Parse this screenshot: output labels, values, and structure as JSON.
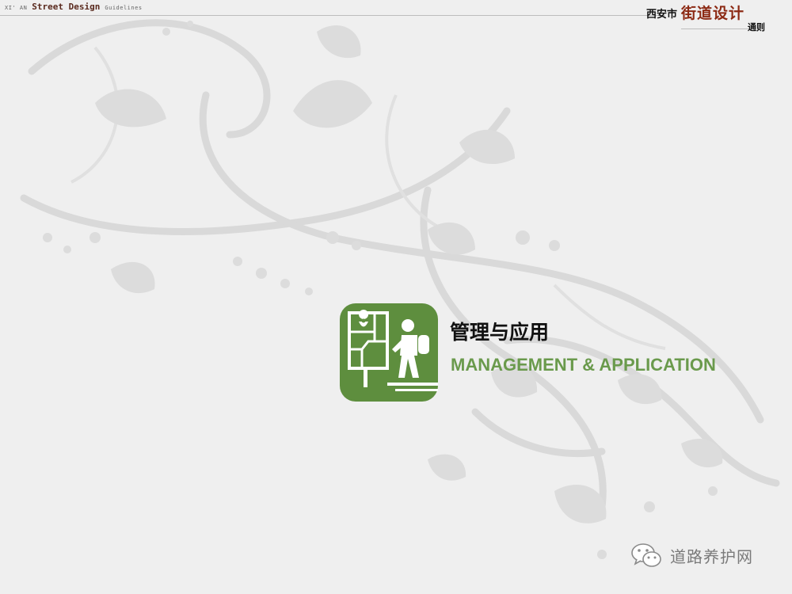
{
  "header": {
    "location_small": "XI' AN",
    "title_en": "Street Design",
    "subtitle_en": "Guidelines",
    "city": "西安市",
    "title_cn": "街道设计",
    "subtitle_cn": "通则"
  },
  "section": {
    "title_cn": "管理与应用",
    "title_en": "MANAGEMENT & APPLICATION",
    "icon_color": "#5e8e3e"
  },
  "watermark": {
    "text": "道路养护网"
  },
  "colors": {
    "background": "#efefef",
    "accent_green": "#6a9a4c",
    "title_red": "#8c2a14"
  }
}
